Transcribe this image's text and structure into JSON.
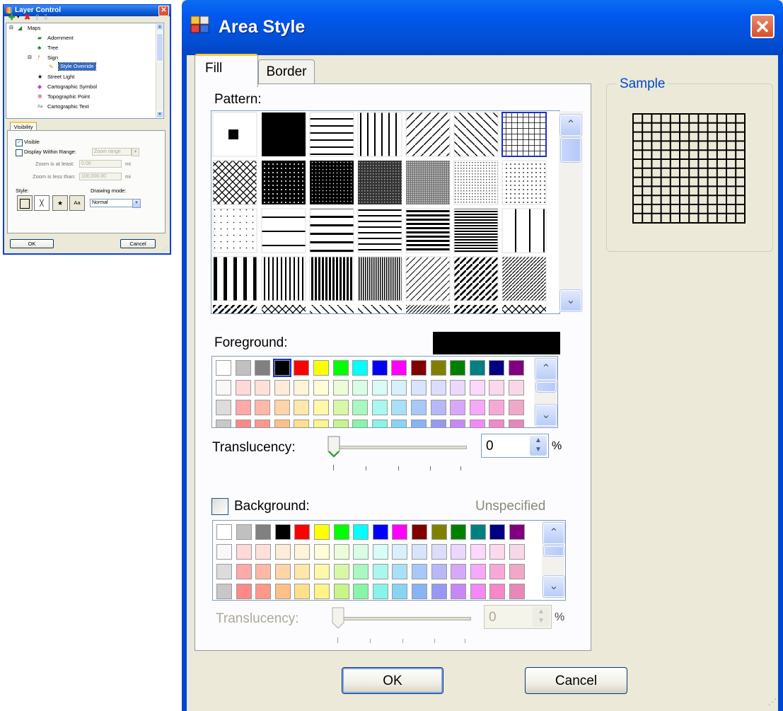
{
  "layer_control": {
    "title": "Layer Control",
    "tree": [
      {
        "label": "Maps",
        "icon": "maps-icon"
      },
      {
        "label": "Adornment",
        "icon": "adornment-icon"
      },
      {
        "label": "Tree",
        "icon": "tree-icon"
      },
      {
        "label": "Sign",
        "icon": "sign-icon"
      },
      {
        "label": "Style Override",
        "icon": "style-override-icon"
      },
      {
        "label": "Street Light",
        "icon": "star-icon"
      },
      {
        "label": "Cartographic Symbol",
        "icon": "diamond-icon"
      },
      {
        "label": "Topographic Point",
        "icon": "cross-icon"
      },
      {
        "label": "Cartographic Text",
        "icon": "text-icon"
      }
    ],
    "tab_visibility": "Visibility",
    "visible_label": "Visible",
    "display_range_label": "Display Within Range:",
    "zoom_range_placeholder": "Zoom range",
    "zoom_at_least_label": "Zoom is at least:",
    "zoom_at_least_value": "0.00",
    "zoom_less_than_label": "Zoom is less than:",
    "zoom_less_than_value": "100,000.00",
    "unit": "mi",
    "style_label": "Style:",
    "style_text_button": "Aa",
    "drawing_mode_label": "Drawing mode:",
    "drawing_mode_value": "Normal",
    "ok": "OK",
    "cancel": "Cancel"
  },
  "area_style": {
    "title": "Area Style",
    "tabs": {
      "fill": "Fill",
      "border": "Border"
    },
    "pattern_label": "Pattern:",
    "foreground_label": "Foreground:",
    "foreground_color": "#000000",
    "translucency_label": "Translucency:",
    "translucency_value": "0",
    "percent": "%",
    "background_label": "Background:",
    "background_status": "Unspecified",
    "bg_translucency_value": "0",
    "sample_title": "Sample",
    "ok": "OK",
    "cancel": "Cancel",
    "fg_palette_row1": [
      "#ffffff",
      "#c0c0c0",
      "#808080",
      "#000000",
      "#ff0000",
      "#ffff00",
      "#00ff00",
      "#00ffff",
      "#0000ff",
      "#ff00ff",
      "#800000",
      "#808000",
      "#008000",
      "#008080",
      "#000080",
      "#800080"
    ],
    "palette_row2": [
      "#f8f8f8",
      "#ffd8d8",
      "#ffe0d8",
      "#ffecd8",
      "#fff4d8",
      "#fffcd8",
      "#ecfcd8",
      "#d8fce4",
      "#d8fcf8",
      "#d8f0fc",
      "#d8e4fc",
      "#dcdcfc",
      "#ecd8fc",
      "#fcd8fc",
      "#fcd8ec",
      "#f8d8e8"
    ],
    "palette_row3": [
      "#dcdcdc",
      "#ffa8a8",
      "#ffb8a8",
      "#ffd4a8",
      "#ffe8a8",
      "#fff8a8",
      "#d8f8a8",
      "#a8f8c0",
      "#a8f8f0",
      "#a8e0f8",
      "#a8c8f8",
      "#b8b8f8",
      "#d8a8f8",
      "#f8a8f8",
      "#f8a8d8",
      "#f0a8c8"
    ],
    "palette_row4": [
      "#c8c8c8",
      "#ff8888",
      "#ff9888",
      "#ffc088",
      "#ffe088",
      "#fff488",
      "#c8f488",
      "#88f4a8",
      "#88f4e8",
      "#88d4f4",
      "#88b4f4",
      "#9898f4",
      "#c888f4",
      "#f488f4",
      "#f488c8",
      "#e888b8"
    ],
    "fg_selected_index": 3
  }
}
